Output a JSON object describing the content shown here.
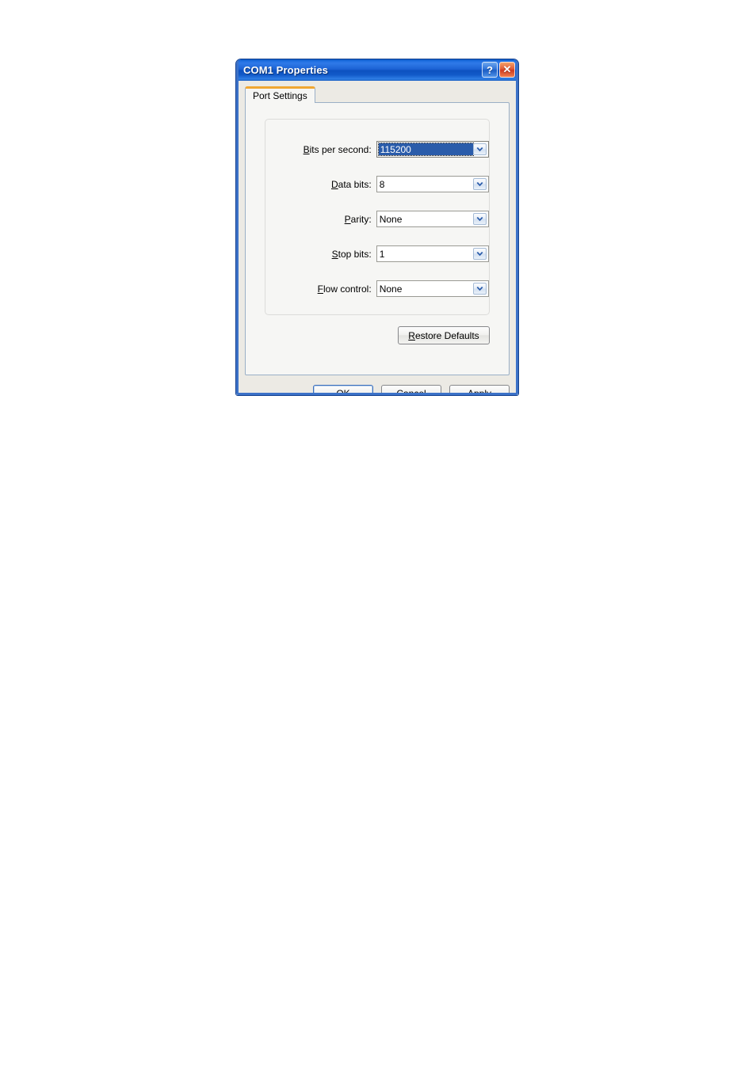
{
  "dialog": {
    "title": "COM1 Properties",
    "titlebar_buttons": [
      {
        "name": "help",
        "glyph": "?"
      },
      {
        "name": "close",
        "glyph": "✕"
      }
    ],
    "tabs": [
      {
        "label": "Port Settings",
        "active": true
      }
    ],
    "fields": [
      {
        "id": "bits-per-second",
        "label_prefix": "",
        "label_mnemonic": "B",
        "label_suffix": "its per second:",
        "value": "115200",
        "focused": true
      },
      {
        "id": "data-bits",
        "label_prefix": "",
        "label_mnemonic": "D",
        "label_suffix": "ata bits:",
        "value": "8",
        "focused": false
      },
      {
        "id": "parity",
        "label_prefix": "",
        "label_mnemonic": "P",
        "label_suffix": "arity:",
        "value": "None",
        "focused": false
      },
      {
        "id": "stop-bits",
        "label_prefix": "",
        "label_mnemonic": "S",
        "label_suffix": "top bits:",
        "value": "1",
        "focused": false
      },
      {
        "id": "flow-control",
        "label_prefix": "",
        "label_mnemonic": "F",
        "label_suffix": "low control:",
        "value": "None",
        "focused": false
      }
    ],
    "restore_defaults": {
      "mnemonic": "R",
      "suffix": "estore Defaults"
    },
    "footer_buttons": [
      {
        "id": "ok",
        "prefix": "",
        "mnemonic": "O",
        "suffix": "K",
        "default": true
      },
      {
        "id": "cancel",
        "prefix": "Cancel",
        "mnemonic": "",
        "suffix": "",
        "default": false
      },
      {
        "id": "apply",
        "prefix": "",
        "mnemonic": "A",
        "suffix": "pply",
        "default": false
      }
    ],
    "colors": {
      "titlebar_blue": "#1b62d4",
      "tab_accent_orange": "#f0a732",
      "selection_blue": "#2a5caa",
      "close_red": "#cf3c20",
      "dialog_face": "#eceae4",
      "panel_face": "#f6f6f4"
    }
  }
}
